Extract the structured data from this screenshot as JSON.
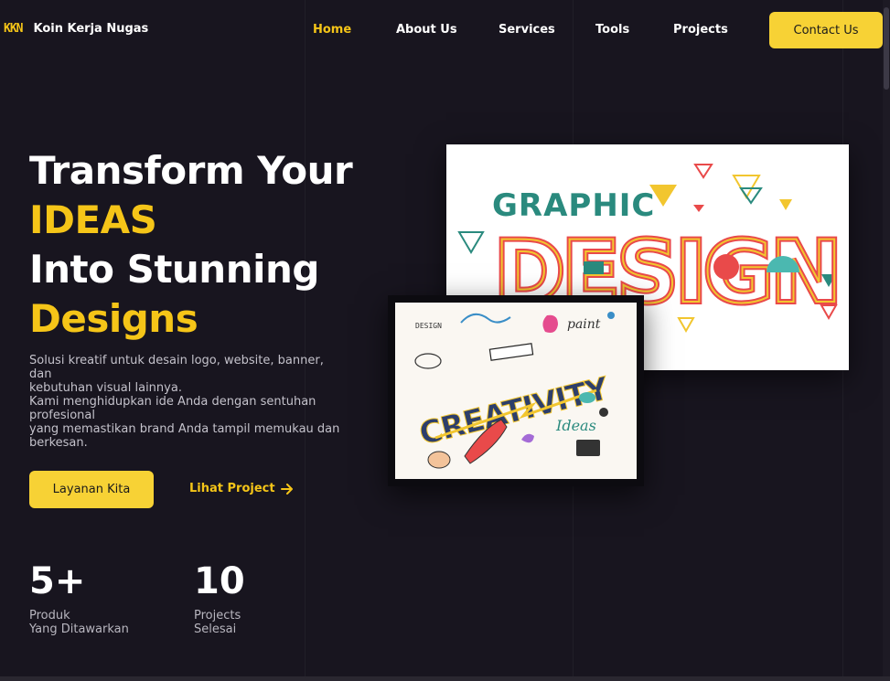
{
  "nav": {
    "logo_mark": "KKN",
    "brand": "Koin Kerja Nugas",
    "links": [
      {
        "label": "Home",
        "active": true
      },
      {
        "label": "About Us",
        "active": false
      },
      {
        "label": "Services",
        "active": false
      },
      {
        "label": "Tools",
        "active": false
      },
      {
        "label": "Projects",
        "active": false
      }
    ],
    "contact_label": "Contact Us"
  },
  "hero": {
    "title_line1": "Transform Your",
    "title_line2": "IDEAS",
    "title_line3": "Into Stunning",
    "title_line4": "Designs",
    "desc_lines": [
      "Solusi kreatif untuk desain logo, website, banner, dan",
      "kebutuhan visual lainnya.",
      "Kami menghidupkan ide Anda dengan sentuhan",
      "profesional",
      "yang memastikan brand Anda tampil memukau dan",
      "berkesan."
    ],
    "primary_button": "Layanan Kita",
    "secondary_link": "Lihat Project"
  },
  "stats": [
    {
      "value": "5+",
      "label_line1": "Produk",
      "label_line2": "Yang Ditawarkan"
    },
    {
      "value": "10",
      "label_line1": "Projects",
      "label_line2": "Selesai"
    }
  ],
  "images": {
    "design_art_text": [
      "GRAPHIC",
      "DESIGN"
    ],
    "creative_art_text": [
      "CREATIVITY",
      "Ideas",
      "DESIGN",
      "paint"
    ]
  },
  "colors": {
    "background": "#18151f",
    "accent": "#f5c518",
    "button": "#f7d235"
  }
}
